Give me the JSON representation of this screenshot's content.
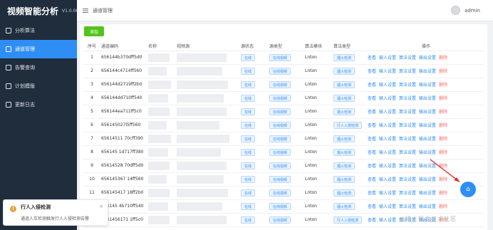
{
  "app": {
    "title": "视频智能分析",
    "version": "V1.0.06"
  },
  "sidebar": {
    "items": [
      {
        "label": "分析算法",
        "icon": "chip-icon",
        "active": false
      },
      {
        "label": "通道管理",
        "icon": "channel-icon",
        "active": true
      },
      {
        "label": "告警查询",
        "icon": "alarm-icon",
        "active": false
      },
      {
        "label": "计划模版",
        "icon": "plan-icon",
        "active": false
      },
      {
        "label": "更新日志",
        "icon": "log-icon",
        "active": false
      }
    ]
  },
  "topbar": {
    "breadcrumb": "通道管理",
    "user": "admin"
  },
  "toolbar": {
    "add_label": "添加"
  },
  "table": {
    "headers": [
      "序号",
      "通道编码",
      "名称",
      "视频源",
      "源状态",
      "源类型",
      "算法模块",
      "算法类型",
      "操作"
    ],
    "ops": [
      "查看",
      "输入设置",
      "算法设置",
      "输出设置",
      "删除"
    ],
    "rows": [
      {
        "seq": "1",
        "code": "656144b370dff5d0",
        "status": "在线",
        "stype": "在线视频",
        "module": "Lnton",
        "atype": "烟火检测"
      },
      {
        "seq": "2",
        "code": "656144c4714ff560",
        "status": "在线",
        "stype": "在线视频",
        "module": "Lnton",
        "atype": "烟火检测"
      },
      {
        "seq": "3",
        "code": "656144d2719ff2b0",
        "status": "在线",
        "stype": "在线视频",
        "module": "Lnton",
        "atype": "烟火检测"
      },
      {
        "seq": "4",
        "code": "656144dd710ff540",
        "status": "在线",
        "stype": "在线视频",
        "module": "Lnton",
        "atype": "烟火检测"
      },
      {
        "seq": "5",
        "code": "656144ea711ff5c0",
        "status": "在线",
        "stype": "在线视频",
        "module": "Lnton",
        "atype": "烟火检测"
      },
      {
        "seq": "6",
        "code": "656145027l5ff560",
        "status": "在线",
        "stype": "在线视频",
        "module": "Lnton",
        "atype": "行人入侵检测"
      },
      {
        "seq": "7",
        "code": "65614511 70cff390",
        "status": "在线",
        "stype": "在线视频",
        "module": "Lnton",
        "atype": "烟火检测"
      },
      {
        "seq": "8",
        "code": "656145 1d717ff380",
        "status": "在线",
        "stype": "在线视频",
        "module": "Lnton",
        "atype": "烟火检测"
      },
      {
        "seq": "9",
        "code": "65614528 70dff5d0",
        "status": "在线",
        "stype": "在线视频",
        "module": "Lnton",
        "atype": "烟火检测"
      },
      {
        "seq": "10",
        "code": "656145367 14ff560",
        "status": "在线",
        "stype": "在线视频",
        "module": "Lnton",
        "atype": "烟火检测"
      },
      {
        "seq": "11",
        "code": "656145417 18ff2b0",
        "status": "在线",
        "stype": "在线视频",
        "module": "Lnton",
        "atype": "烟火检测"
      },
      {
        "seq": "",
        "code": "656145 4b710ff540",
        "status": "在线",
        "stype": "在线视频",
        "module": "Lnton",
        "atype": "烟火检测"
      },
      {
        "seq": "",
        "code": "6561456171 1ff5c0",
        "status": "在线",
        "stype": "在线视频",
        "module": "Lnton",
        "atype": "行人入侵检测"
      }
    ]
  },
  "toast": {
    "title": "行人入侵检测",
    "message": "通道人车检测触发行人入侵检测告警"
  },
  "watermark": "@稀土掘金技术社区",
  "colors": {
    "primary": "#2f8ef3",
    "sidebar": "#1f2d3d",
    "success": "#52c41a",
    "danger": "#f56c6c",
    "warning": "#e6a23c"
  }
}
